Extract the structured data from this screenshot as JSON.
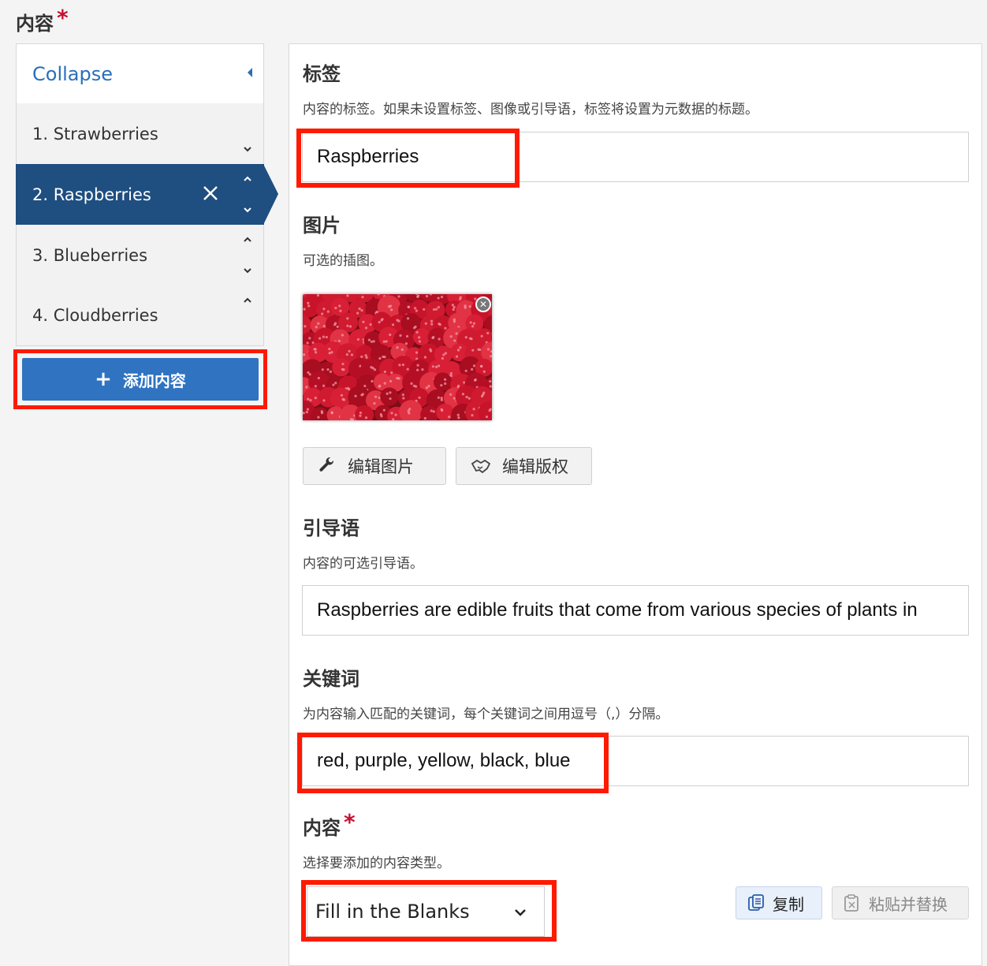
{
  "header": {
    "title": "内容",
    "required_mark": "*"
  },
  "sidebar": {
    "collapse_label": "Collapse",
    "items": [
      {
        "label": "1. Strawberries"
      },
      {
        "label": "2. Raspberries",
        "active": true
      },
      {
        "label": "3. Blueberries"
      },
      {
        "label": "4. Cloudberries"
      }
    ],
    "add_button_label": "添加内容",
    "add_icon": "+"
  },
  "form": {
    "label_field": {
      "title": "标签",
      "description": "内容的标签。如果未设置标签、图像或引导语，标签将设置为元数据的标题。",
      "value": "Raspberries"
    },
    "image_field": {
      "title": "图片",
      "description": "可选的插图。",
      "image_subject": "raspberries",
      "edit_image_label": "编辑图片",
      "edit_copyright_label": "编辑版权"
    },
    "intro_field": {
      "title": "引导语",
      "description": "内容的可选引导语。",
      "value": "Raspberries are edible fruits that come from various species of plants in"
    },
    "keywords_field": {
      "title": "关键词",
      "description": "为内容输入匹配的关键词，每个关键词之间用逗号（,）分隔。",
      "value": "red, purple, yellow, black, blue"
    },
    "content_field": {
      "title": "内容",
      "required_mark": "*",
      "description": "选择要添加的内容类型。",
      "selected_type": "Fill in the Blanks",
      "copy_label": "复制",
      "paste_label": "粘贴并替换"
    }
  },
  "colors": {
    "accent": "#2f73c1",
    "active_item": "#1f4e80",
    "highlight": "#ff1a00",
    "required": "#c8102e"
  }
}
